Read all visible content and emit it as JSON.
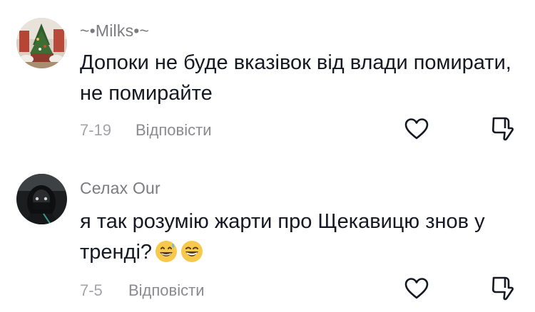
{
  "comments": [
    {
      "username": "~•Milks•~",
      "text": "Допоки не буде вказівок від влади помирати, не помирайте",
      "date": "7-19",
      "reply_label": "Відповісти",
      "avatar": "christmas-tree-avatar",
      "emojis": []
    },
    {
      "username": "Селах Our",
      "text": "я так розумію жарти про Щекавицю знов у тренді?",
      "date": "7-5",
      "reply_label": "Відповісти",
      "avatar": "hooded-figure-avatar",
      "emojis": [
        "grinning-sweat-emoji",
        "grinning-squinting-emoji"
      ]
    }
  ],
  "icons": {
    "like": "heart-icon",
    "dislike": "thumbs-down-icon"
  },
  "colors": {
    "text": "#161823",
    "username": "#7b7b80",
    "meta": "#a3a3a8",
    "icon": "#161823"
  }
}
